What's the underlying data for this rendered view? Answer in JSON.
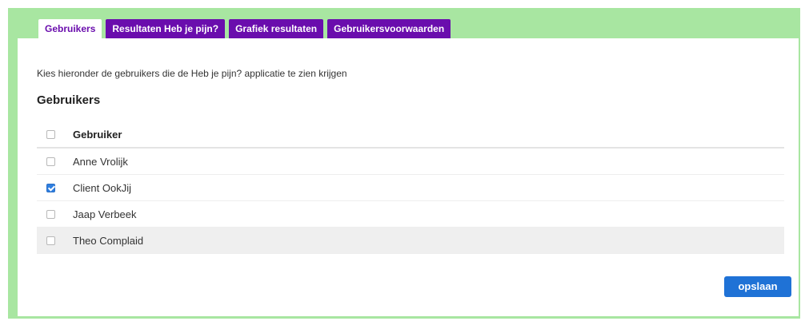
{
  "tabs": [
    {
      "label": "Gebruikers",
      "active": true
    },
    {
      "label": "Resultaten Heb je pijn?",
      "active": false
    },
    {
      "label": "Grafiek resultaten",
      "active": false
    },
    {
      "label": "Gebruikersvoorwaarden",
      "active": false
    }
  ],
  "intro_text": "Kies hieronder de gebruikers die de Heb je pijn? applicatie te zien krijgen",
  "section_title": "Gebruikers",
  "table": {
    "header": {
      "label": "Gebruiker",
      "checked": false
    },
    "rows": [
      {
        "name": "Anne Vrolijk",
        "checked": false
      },
      {
        "name": "Client OokJij",
        "checked": true
      },
      {
        "name": "Jaap Verbeek",
        "checked": false
      },
      {
        "name": "Theo Complaid",
        "checked": false
      }
    ]
  },
  "save_button": "opslaan",
  "colors": {
    "frame_green": "#a8e6a1",
    "tab_purple": "#6a0dad",
    "button_blue": "#1f72d6",
    "checkbox_blue": "#2f7fe0"
  }
}
